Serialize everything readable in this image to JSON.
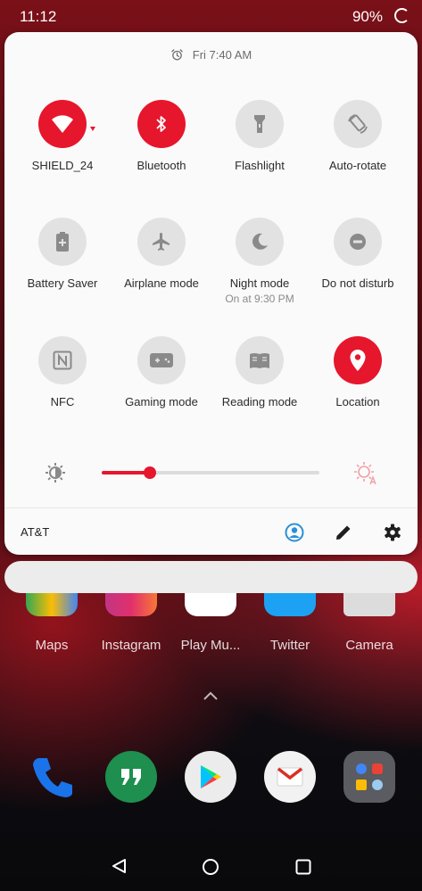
{
  "status_bar": {
    "time": "11:12",
    "battery": "90%"
  },
  "quick_settings": {
    "alarm": "Fri 7:40 AM",
    "tiles": [
      {
        "label": "SHIELD_24",
        "icon": "wifi-icon",
        "active": true
      },
      {
        "label": "Bluetooth",
        "icon": "bluetooth-icon",
        "active": true
      },
      {
        "label": "Flashlight",
        "icon": "flashlight-icon",
        "active": false
      },
      {
        "label": "Auto-rotate",
        "icon": "auto-rotate-icon",
        "active": false
      },
      {
        "label": "Battery Saver",
        "icon": "battery-saver-icon",
        "active": false
      },
      {
        "label": "Airplane mode",
        "icon": "airplane-icon",
        "active": false
      },
      {
        "label": "Night mode",
        "sublabel": "On at 9:30 PM",
        "icon": "moon-icon",
        "active": false
      },
      {
        "label": "Do not disturb",
        "icon": "do-not-disturb-icon",
        "active": false
      },
      {
        "label": "NFC",
        "icon": "nfc-icon",
        "active": false
      },
      {
        "label": "Gaming mode",
        "icon": "gamepad-icon",
        "active": false
      },
      {
        "label": "Reading mode",
        "icon": "book-icon",
        "active": false
      },
      {
        "label": "Location",
        "icon": "location-pin-icon",
        "active": true
      }
    ],
    "brightness": {
      "level": 0.22
    },
    "footer": {
      "carrier": "AT&T"
    }
  },
  "home_apps": [
    "Maps",
    "Instagram",
    "Play Mu...",
    "Twitter",
    "Camera"
  ],
  "dock": [
    "phone-icon",
    "hangouts-icon",
    "play-store-icon",
    "gmail-icon",
    "google-folder-icon"
  ],
  "colors": {
    "accent": "#e6162d",
    "tile_off": "#e2e2e2",
    "panel": "#fafafa"
  }
}
